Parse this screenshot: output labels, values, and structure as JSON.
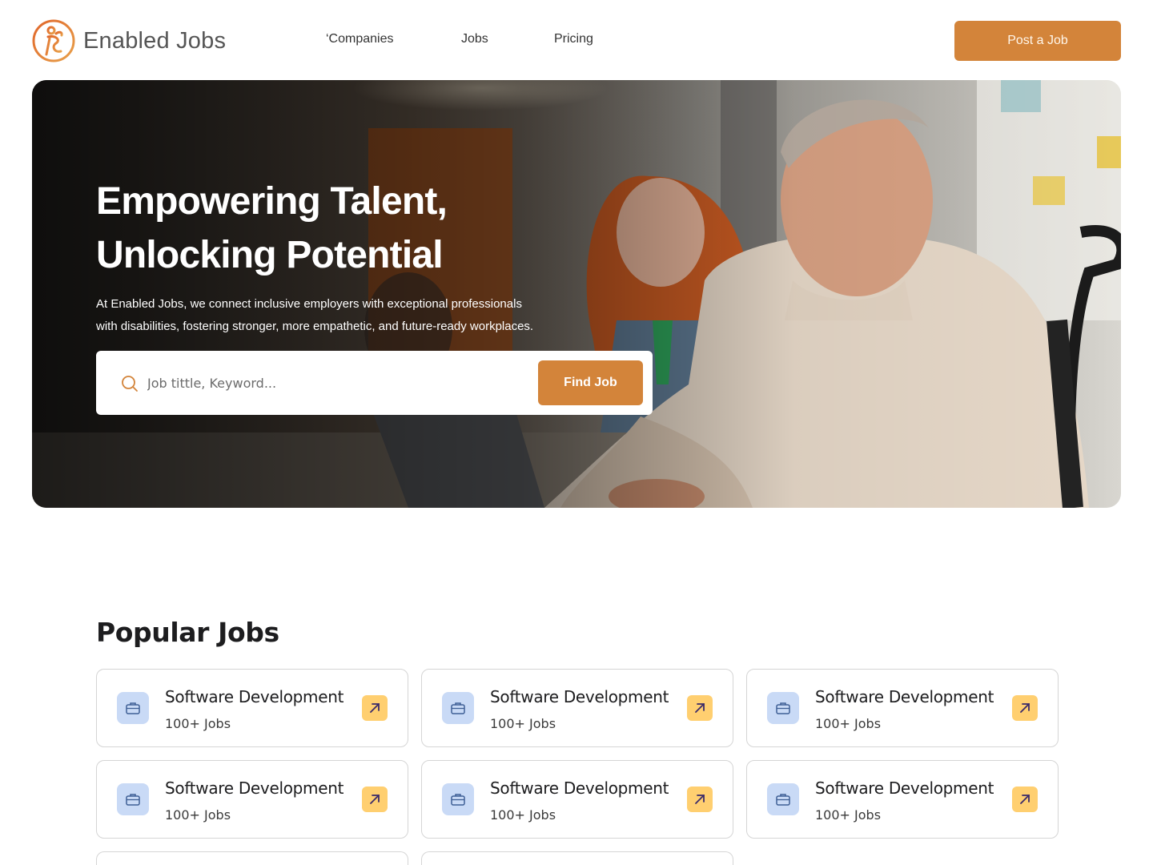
{
  "header": {
    "brand_name": "Enabled Jobs",
    "nav": [
      {
        "label": "‘Companies"
      },
      {
        "label": "Jobs"
      },
      {
        "label": "Pricing"
      }
    ],
    "post_job_label": "Post a Job"
  },
  "hero": {
    "title_line1": "Empowering Talent,",
    "title_line2": "Unlocking Potential",
    "description_line1": "At Enabled Jobs, we connect inclusive employers with exceptional professionals",
    "description_line2": "with disabilities, fostering stronger, more empathetic, and future-ready workplaces.",
    "search_placeholder": "Job tittle, Keyword...",
    "find_job_label": "Find Job"
  },
  "popular_jobs": {
    "title": "Popular Jobs",
    "cards": [
      {
        "title": "Software Development",
        "count": "100+ Jobs"
      },
      {
        "title": "Software Development",
        "count": "100+ Jobs"
      },
      {
        "title": "Software Development",
        "count": "100+ Jobs"
      },
      {
        "title": "Software Development",
        "count": "100+ Jobs"
      },
      {
        "title": "Software Development",
        "count": "100+ Jobs"
      },
      {
        "title": "Software Development",
        "count": "100+ Jobs"
      },
      {
        "title": "",
        "count": ""
      },
      {
        "title": "",
        "count": ""
      }
    ]
  },
  "colors": {
    "accent": "#d3843a",
    "job_icon_bg": "#c9daf6",
    "arrow_bg": "#ffcf70"
  },
  "icons": {
    "logo": "person-circle-logo",
    "search": "search-icon",
    "job": "briefcase-icon",
    "arrow": "arrow-up-right-icon"
  }
}
